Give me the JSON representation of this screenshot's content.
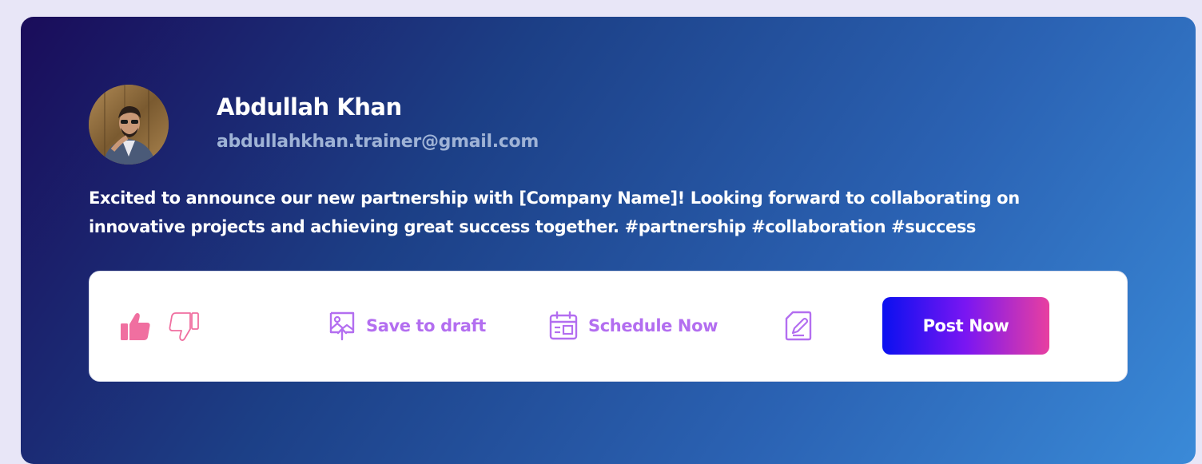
{
  "profile": {
    "name": "Abdullah Khan",
    "email": "abdullahkhan.trainer@gmail.com"
  },
  "post": {
    "text": "Excited to announce our new partnership with [Company Name]! Looking forward to collaborating on innovative projects and achieving great success together. #partnership #collaboration #success"
  },
  "actions": {
    "like_icon": "thumbs-up-icon",
    "dislike_icon": "thumbs-down-icon",
    "save_draft_label": "Save to draft",
    "schedule_label": "Schedule Now",
    "edit_icon": "edit-icon",
    "post_now_label": "Post Now"
  },
  "colors": {
    "accent_purple": "#b36ef0",
    "like_pink": "#f06fa0",
    "post_gradient_start": "#0a10f0",
    "post_gradient_end": "#e83fa0"
  }
}
